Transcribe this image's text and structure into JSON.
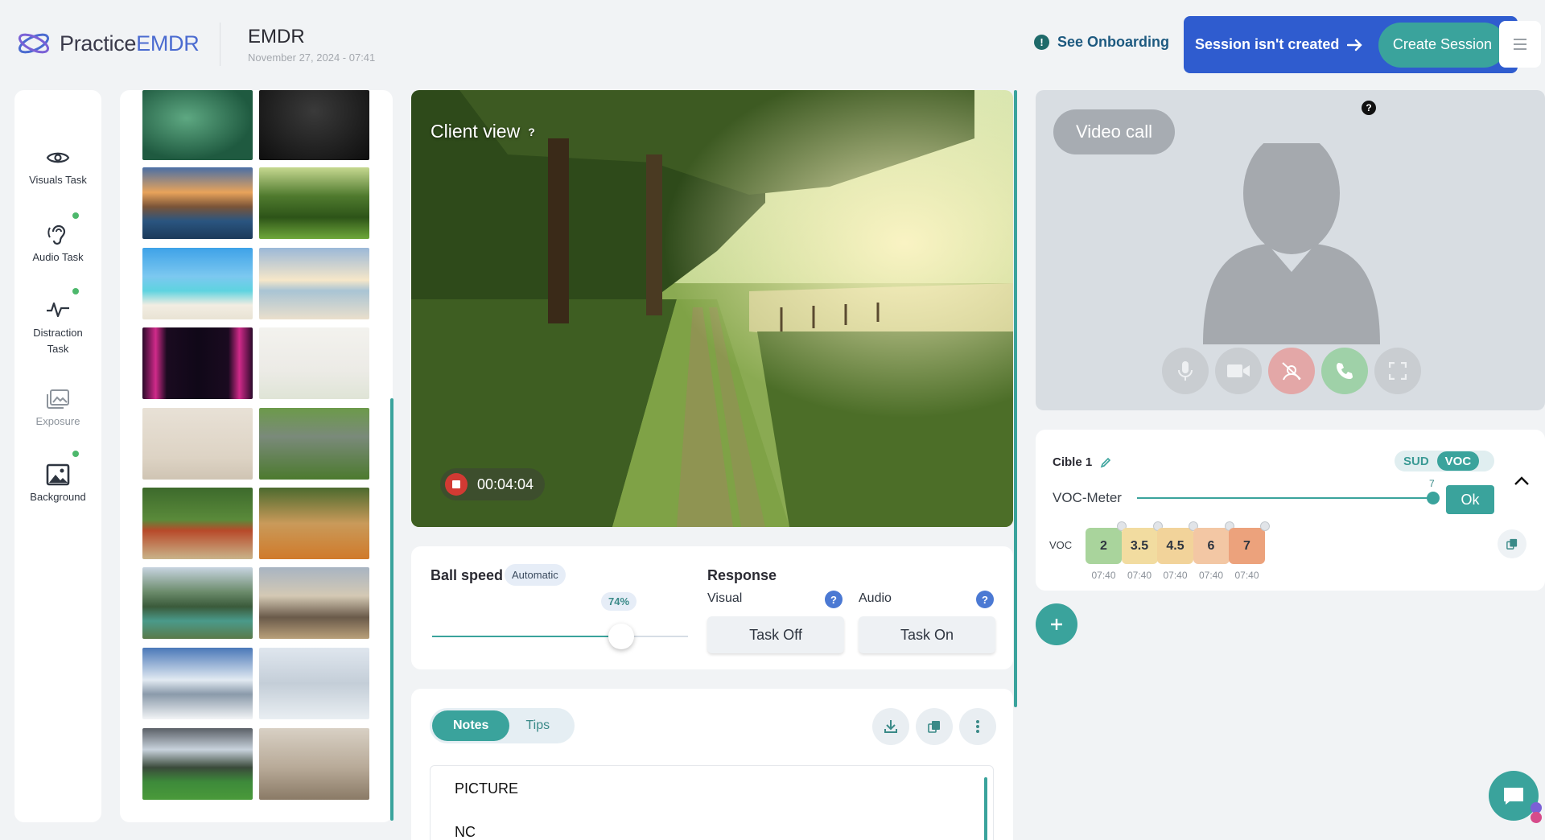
{
  "header": {
    "logo_text_a": "Practice",
    "logo_text_b": "EMDR",
    "title": "EMDR",
    "date": "November 27, 2024 - 07:41",
    "onboarding": "See Onboarding",
    "session_status": "Session isn't created",
    "create_session": "Create Session",
    "brand_color": "#4b6bd0",
    "accent_color": "#3aa39c"
  },
  "nav": {
    "items": [
      {
        "label": "Visuals Task",
        "icon": "eye-icon",
        "active": false
      },
      {
        "label": "Audio Task",
        "icon": "ear-icon",
        "active": true
      },
      {
        "label": "Distraction Task",
        "icon": "pulse-icon",
        "active": true
      },
      {
        "label": "Exposure",
        "icon": "images-icon",
        "active": false
      },
      {
        "label": "Background",
        "icon": "image-icon",
        "active": true
      }
    ]
  },
  "client": {
    "label": "Client view",
    "help": "?",
    "timer": "00:04:04"
  },
  "controls": {
    "ball_speed": "Ball speed",
    "automatic": "Automatic",
    "speed_percent_label": "74%",
    "speed_value": 0.74,
    "response": "Response",
    "visual": "Visual",
    "audio": "Audio",
    "task_off": "Task Off",
    "task_on": "Task On"
  },
  "notes": {
    "tab_notes": "Notes",
    "tab_tips": "Tips",
    "lines": [
      "PICTURE",
      "NC"
    ]
  },
  "video": {
    "label": "Video call",
    "help": "?"
  },
  "cible": {
    "title": "Cible 1",
    "sud": "SUD",
    "voc": "VOC",
    "meter_label": "VOC-Meter",
    "meter_value": "7",
    "meter_fraction": 1.0,
    "ok": "Ok",
    "voc_label": "VOC",
    "chips": [
      {
        "value": "2",
        "time": "07:40",
        "color": "#a9d49c"
      },
      {
        "value": "3.5",
        "time": "07:40",
        "color": "#f2dca0"
      },
      {
        "value": "4.5",
        "time": "07:40",
        "color": "#f2d39a"
      },
      {
        "value": "6",
        "time": "07:40",
        "color": "#f3c7a4"
      },
      {
        "value": "7",
        "time": "07:40",
        "color": "#eca27c"
      }
    ]
  }
}
